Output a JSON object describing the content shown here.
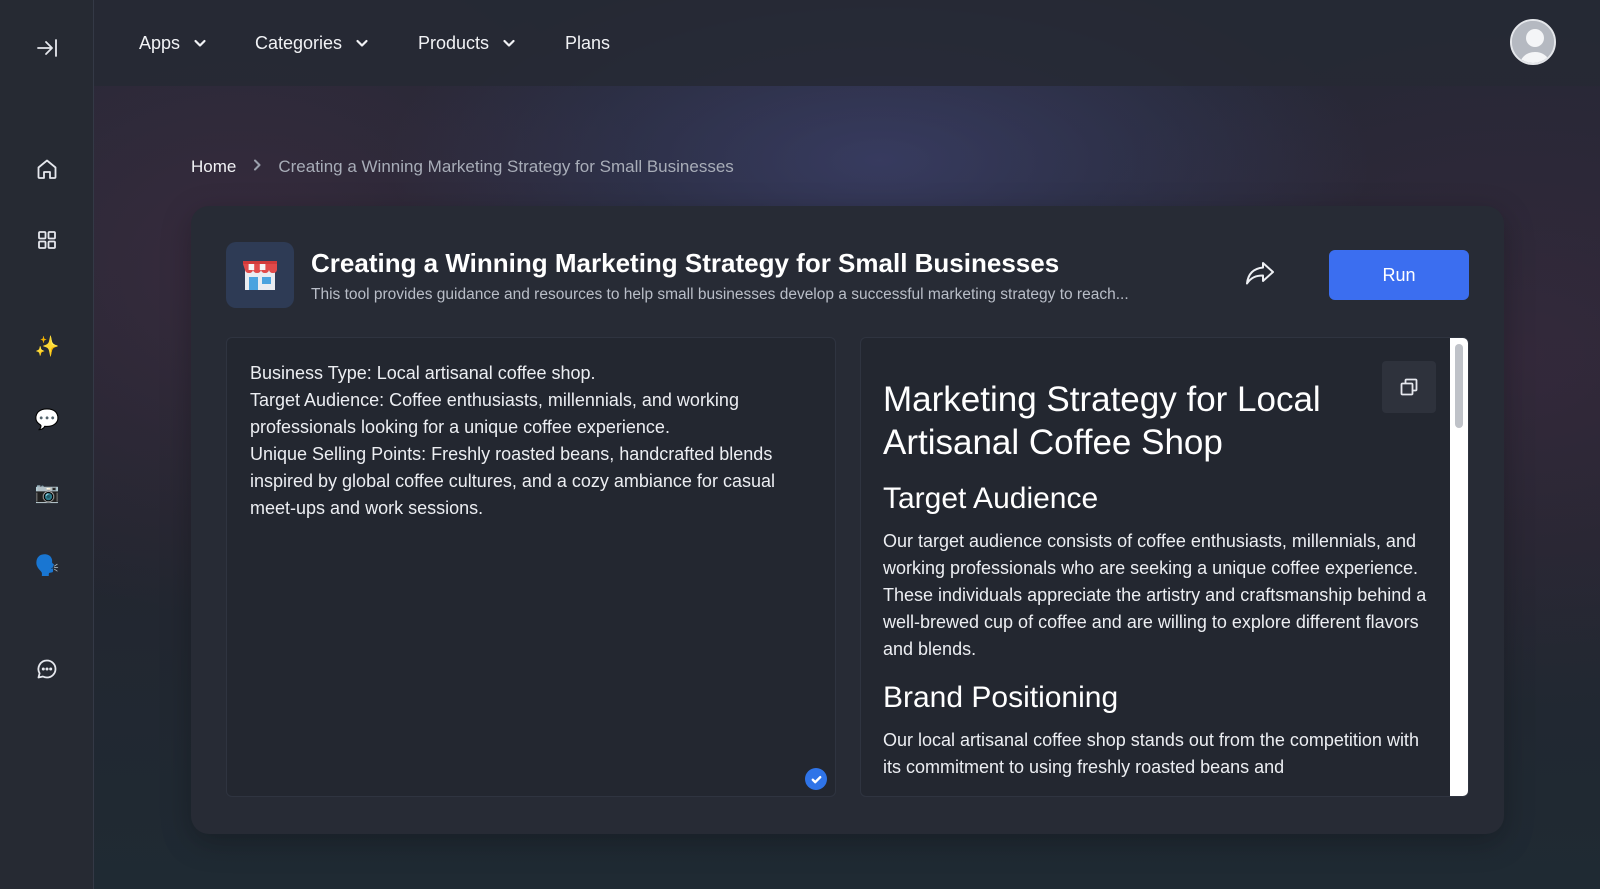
{
  "sidebar": {
    "items": [
      {
        "icon": "collapse-icon"
      },
      {
        "icon": "home-icon"
      },
      {
        "icon": "grid-icon"
      },
      {
        "icon": "sparkles-icon",
        "emoji": "✨"
      },
      {
        "icon": "speech-bubble-icon",
        "emoji": "💬"
      },
      {
        "icon": "camera-icon",
        "emoji": "📷"
      },
      {
        "icon": "speaking-head-icon",
        "emoji": "🗣️"
      },
      {
        "icon": "chat-icon"
      }
    ]
  },
  "topnav": {
    "apps": "Apps",
    "categories": "Categories",
    "products": "Products",
    "plans": "Plans"
  },
  "breadcrumb": {
    "home": "Home",
    "current": "Creating a Winning Marketing Strategy for Small Businesses"
  },
  "tool": {
    "icon": "🏪",
    "title": "Creating a Winning Marketing Strategy for Small Businesses",
    "description": "This tool provides guidance and resources to help small businesses develop a successful marketing strategy to reach...",
    "run_label": "Run"
  },
  "input": {
    "text": "Business Type: Local artisanal coffee shop.\nTarget Audience: Coffee enthusiasts, millennials, and working professionals looking for a unique coffee experience.\nUnique Selling Points: Freshly roasted beans, handcrafted blends inspired by global coffee cultures, and a cozy ambiance for casual meet-ups and work sessions."
  },
  "output": {
    "h1": "Marketing Strategy for Local Artisanal Coffee Shop",
    "section1_heading": "Target Audience",
    "section1_text": "Our target audience consists of coffee enthusiasts, millennials, and working professionals who are seeking a unique coffee experience. These individuals appreciate the artistry and craftsmanship behind a well-brewed cup of coffee and are willing to explore different flavors and blends.",
    "section2_heading": "Brand Positioning",
    "section2_text": "Our local artisanal coffee shop stands out from the competition with its commitment to using freshly roasted beans and"
  },
  "colors": {
    "accent": "#3b6ef0",
    "sidebar_bg": "#262a33",
    "card_bg": "#272b35",
    "panel_bg": "#232730"
  }
}
